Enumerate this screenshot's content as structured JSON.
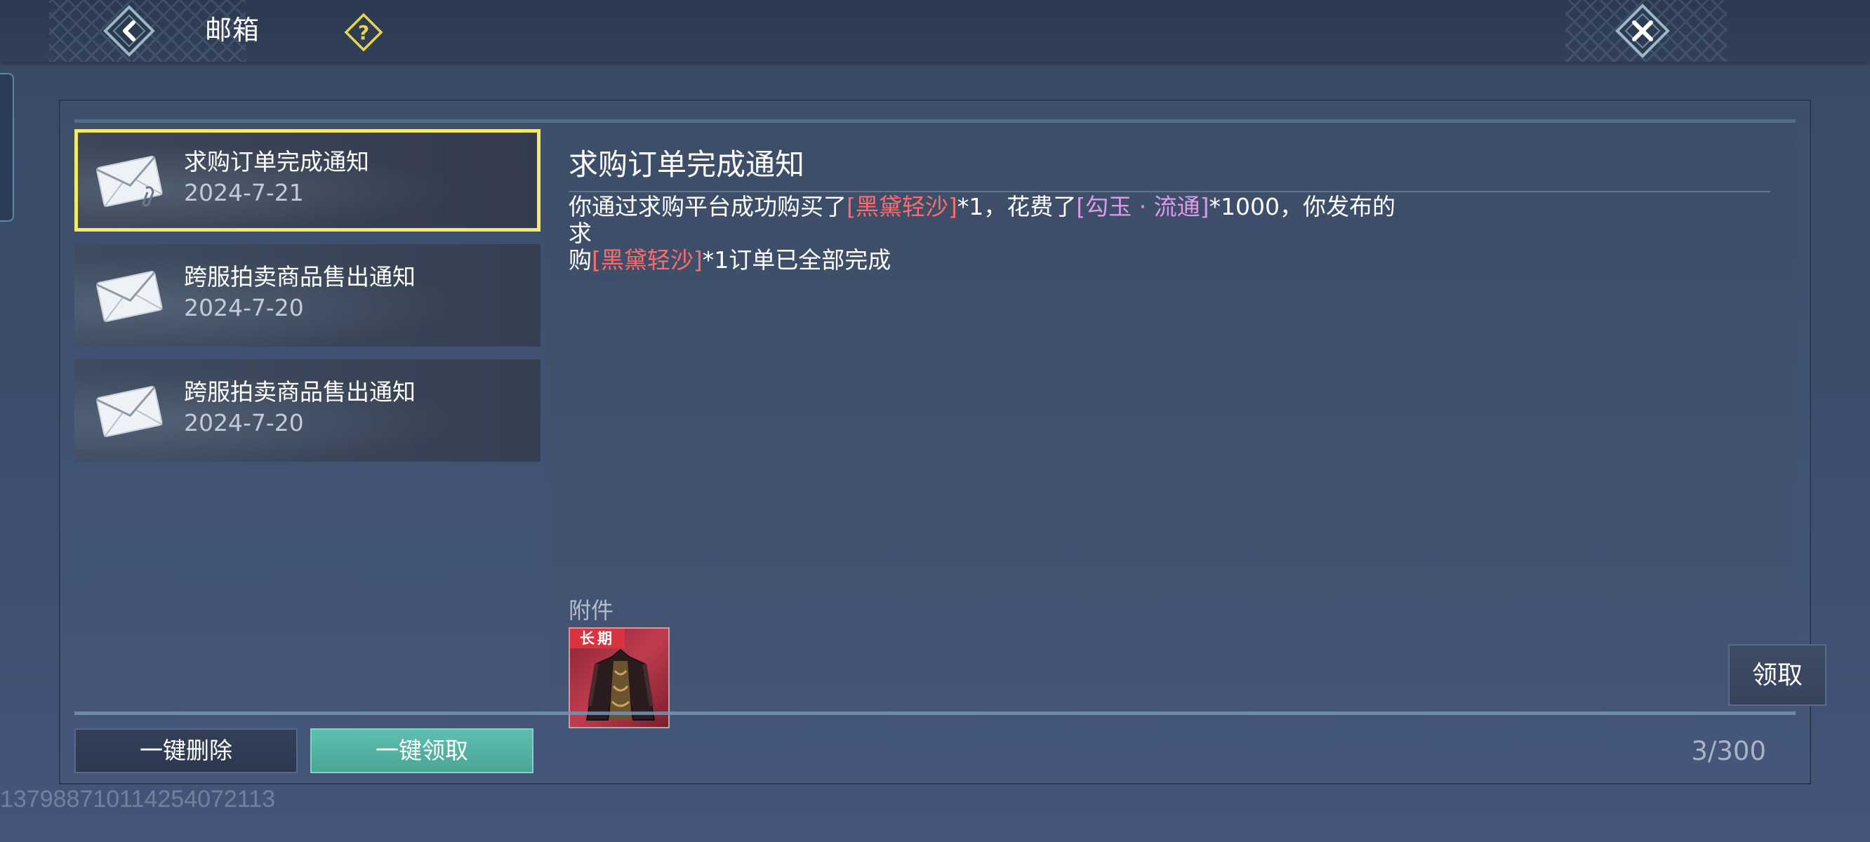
{
  "header": {
    "title": "邮箱",
    "back_icon": "back-arrow-icon",
    "help_icon": "question-mark-icon",
    "close_icon": "close-x-icon"
  },
  "mail_list": [
    {
      "title": "求购订单完成通知",
      "date": "2024-7-21",
      "selected": true,
      "has_attachment": true
    },
    {
      "title": "跨服拍卖商品售出通知",
      "date": "2024-7-20",
      "selected": false,
      "has_attachment": false
    },
    {
      "title": "跨服拍卖商品售出通知",
      "date": "2024-7-20",
      "selected": false,
      "has_attachment": false
    }
  ],
  "detail": {
    "title": "求购订单完成通知",
    "body": {
      "p1": "你通过求购平台成功购买了",
      "item1": "[黑黛轻沙]",
      "p2": "*1，花费了",
      "currency": "[勾玉 · 流通]",
      "p3": "*1000，你发布的求",
      "p4": "购",
      "item2": "[黑黛轻沙]",
      "p5": "*1订单已全部完成"
    },
    "attachment_label": "附件",
    "attachment": {
      "badge": "长期",
      "name": "黑黛轻沙"
    },
    "claim_label": "领取"
  },
  "footer": {
    "delete_all_label": "一键删除",
    "claim_all_label": "一键领取",
    "count": "3/300"
  },
  "user_id": "137988710114254072113",
  "colors": {
    "selected_border": "#f4ea6a",
    "item_highlight": "#ff6b6b",
    "currency_highlight": "#d99ae8",
    "claim_all_bg": "#5fbfae"
  }
}
